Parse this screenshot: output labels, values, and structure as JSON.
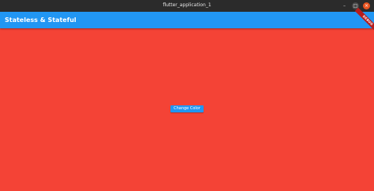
{
  "window": {
    "title": "flutter_application_1",
    "controls": {
      "minimize_icon": "minimize-icon",
      "maximize_icon": "maximize-icon",
      "close_icon": "close-icon",
      "minimize_glyph": "–",
      "maximize_glyph": "□",
      "close_glyph": "×"
    }
  },
  "appbar": {
    "title": "Stateless & Stateful",
    "color": "#2196f3"
  },
  "debug_banner": {
    "label": "DEBUG"
  },
  "body": {
    "background_color": "#f44336",
    "button_label": "Change Color",
    "button_color": "#2196f3"
  }
}
